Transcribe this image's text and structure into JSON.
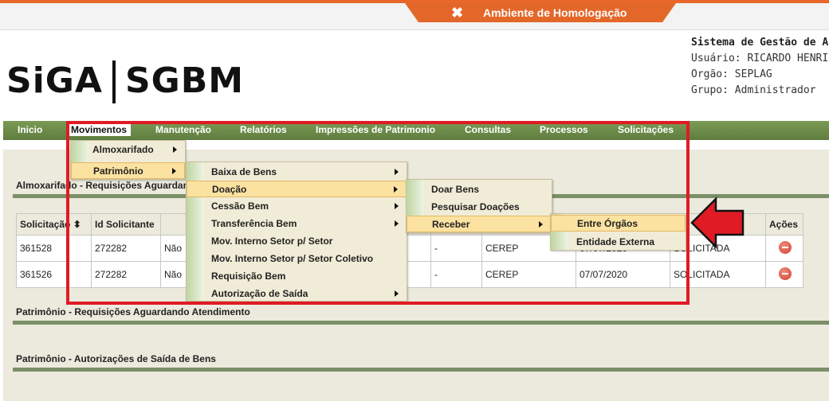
{
  "banner": {
    "text": "Ambiente de Homologação",
    "icon": "tools-icon"
  },
  "logo": {
    "left": "SiGA",
    "right": "SGBM"
  },
  "sysinfo": {
    "title": "Sistema de Gestão de A",
    "usuario": "Usuário: RICARDO HENRI",
    "orgao": "Orgão: SEPLAG",
    "grupo": "Grupo: Administrador"
  },
  "menubar": {
    "items": [
      "Inicio",
      "Movimentos",
      "Manutenção",
      "Relatórios",
      "Impressões de Patrimonio",
      "Consultas",
      "Processos",
      "Solicitações"
    ]
  },
  "sections": {
    "almox_title": "Almoxarifado - Requisições Aguardando Atendimento",
    "patr_title": "Patrimônio - Requisições Aguardando Atendimento",
    "aut_title": "Patrimônio - Autorizações de Saída de Bens"
  },
  "table": {
    "headers": [
      "Solicitação ⬍",
      "Id Solicitante",
      "",
      "",
      "",
      "",
      "",
      "",
      "Ações"
    ],
    "rows": [
      [
        "361528",
        "272282",
        "Não",
        "",
        "-",
        "CEREP",
        "07/07/2020",
        "SOLICITADA"
      ],
      [
        "361526",
        "272282",
        "Não",
        "",
        "-",
        "CEREP",
        "07/07/2020",
        "SOLICITADA"
      ]
    ]
  },
  "menu_movimentos": [
    "Almoxarifado",
    "Patrimônio"
  ],
  "menu_patrimonio": [
    "Baixa de Bens",
    "Doação",
    "Cessão Bem",
    "Transferência Bem",
    "Mov. Interno Setor p/ Setor",
    "Mov. Interno Setor p/ Setor Coletivo",
    "Requisição Bem",
    "Autorização de Saída"
  ],
  "menu_doacao": [
    "Doar Bens",
    "Pesquisar Doações",
    "Receber"
  ],
  "menu_receber": [
    "Entre Órgãos",
    "Entidade Externa"
  ],
  "colors": {
    "menubar": "#6b8a49",
    "accent": "#e4672a",
    "highlight": "#e01b24"
  }
}
